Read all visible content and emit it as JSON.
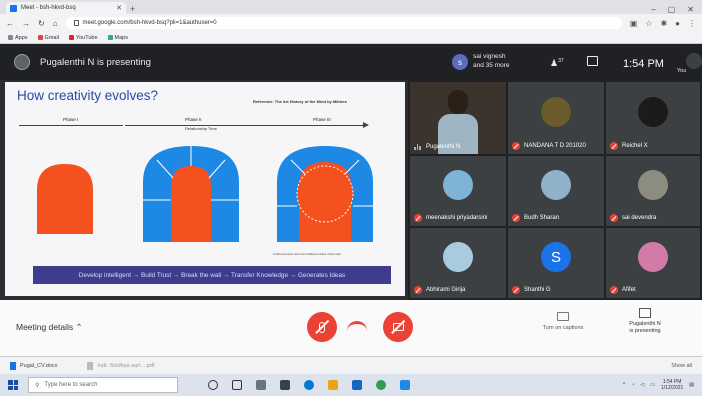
{
  "browser": {
    "tab_title": "Meet - bsh-hkvd-bsq",
    "url": "meet.google.com/bsh-hkvd-bsq?pli=1&authuser=0",
    "bookmarks": [
      "Apps",
      "Gmail",
      "YouTube",
      "Maps"
    ]
  },
  "meet": {
    "presenting_label": "Pugalenthi N is presenting",
    "viewer_initial": "s",
    "viewers_line1": "sai vignesh",
    "viewers_line2": "and 35 more",
    "people_count": "37",
    "clock": "1:54 PM",
    "you_label": "You"
  },
  "slide": {
    "title": "How creativity evolves?",
    "reference": "Reference: The Art History of the Mind by Mildres",
    "phase1": "Phase I",
    "phase2": "Phase II",
    "phase3": "Phase III",
    "phase2_sub": "Relationship Time",
    "footnote": "It will encounter fear from different sides of the wall",
    "banner": "Develop intelligent → Build Trust → Break the wall → Transfer Knowledge → Generates Ideas"
  },
  "participants": [
    {
      "name": "Pugalenthi N"
    },
    {
      "name": "NANDANA T D 201020"
    },
    {
      "name": "Reichel X"
    },
    {
      "name": "meenakshi priyadarsini"
    },
    {
      "name": "Budh Sharan"
    },
    {
      "name": "sai devendra"
    },
    {
      "name": "Abhirami Girija"
    },
    {
      "name": "Shanthi G",
      "initial": "S"
    },
    {
      "name": "Afifet"
    }
  ],
  "controls": {
    "meeting_details": "Meeting details",
    "captions": "Turn on captions",
    "presenting_line1": "Pugalenthi N",
    "presenting_line2": "is presenting"
  },
  "downloads": {
    "file1": "Pugal_CV.docx",
    "file2": "Indr. Sindhya aart....pdf",
    "show_all": "Show all"
  },
  "taskbar": {
    "search_placeholder": "Type here to search",
    "time": "1:54 PM",
    "date": "1/12/2021"
  },
  "colors": {
    "accent_red": "#ea4335",
    "slide_orange": "#f4511e",
    "slide_blue": "#1e88e5",
    "banner_purple": "#3f3c8e"
  }
}
